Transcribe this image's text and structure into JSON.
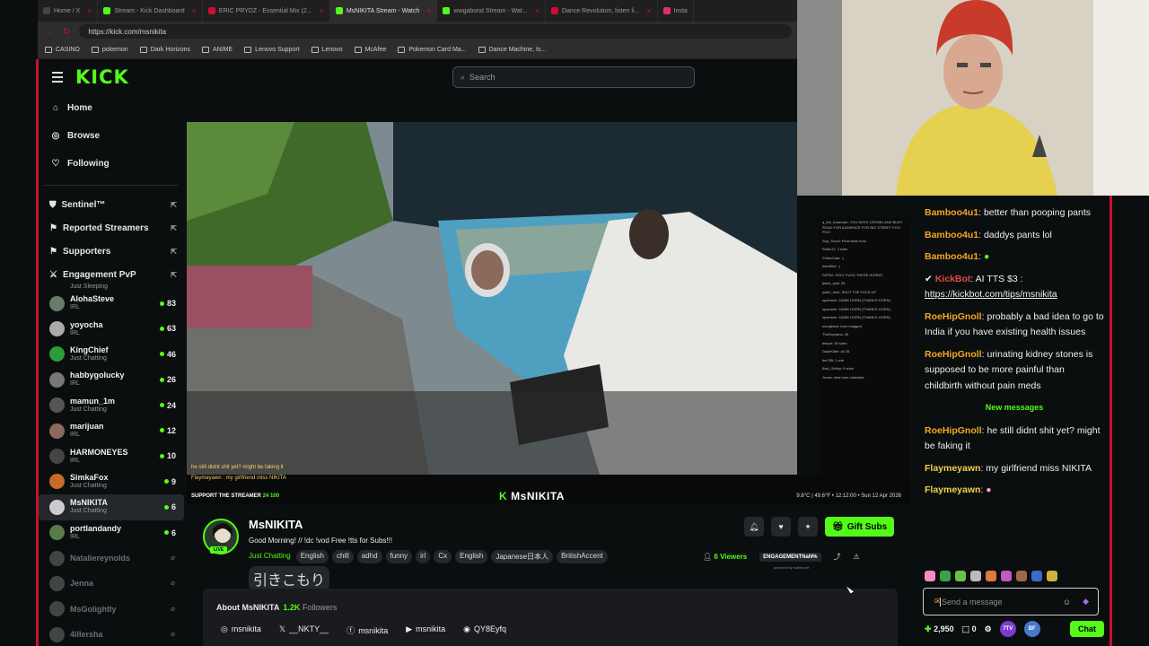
{
  "browser": {
    "tabs": [
      {
        "label": "Home / X",
        "active": false
      },
      {
        "label": "Stream - Kick Dashboard",
        "active": false
      },
      {
        "label": "ERIC PRYDZ - Essential Mix (2...",
        "active": false
      },
      {
        "label": "MsNIKITA Stream - Watch",
        "active": true
      },
      {
        "label": "wwgabond Stream - Wat...",
        "active": false
      },
      {
        "label": "Dance Revolution, listen li...",
        "active": false
      },
      {
        "label": "Insta",
        "active": false
      }
    ],
    "url": "https://kick.com/msnikita",
    "bookmarks": [
      "CASINO",
      "pokemon",
      "Dark Horizons",
      "ANIME",
      "Lenovo Support",
      "Lenovo",
      "McAfee",
      "Pokemon Card Ma...",
      "Dance Machine, Is..."
    ]
  },
  "header": {
    "logo": "KICK",
    "search_placeholder": "Search"
  },
  "sidebar": {
    "nav": [
      {
        "label": "Home",
        "icon": "home-icon"
      },
      {
        "label": "Browse",
        "icon": "compass-icon"
      },
      {
        "label": "Following",
        "icon": "heart-icon"
      }
    ],
    "sections": [
      {
        "label": "Sentinel™",
        "icon": "shield-icon"
      },
      {
        "label": "Reported Streamers",
        "icon": "flag-icon"
      },
      {
        "label": "Supporters",
        "icon": "users-icon"
      },
      {
        "label": "Engagement PvP",
        "icon": "swords-icon"
      }
    ],
    "partial_category": "Just Sleeping",
    "streamers": [
      {
        "name": "AlohaSteve",
        "category": "IRL",
        "viewers": "83",
        "online": true,
        "color": "#6a7a6a"
      },
      {
        "name": "yoyocha",
        "category": "IRL",
        "viewers": "63",
        "online": true,
        "color": "#aaa"
      },
      {
        "name": "KingChief",
        "category": "Just Chatting",
        "viewers": "46",
        "online": true,
        "color": "#2d9c3a"
      },
      {
        "name": "habbygolucky",
        "category": "IRL",
        "viewers": "26",
        "online": true,
        "color": "#777"
      },
      {
        "name": "mamun_1m",
        "category": "Just Chatting",
        "viewers": "24",
        "online": true,
        "color": "#555"
      },
      {
        "name": "marijuan",
        "category": "IRL",
        "viewers": "12",
        "online": true,
        "color": "#8a6a5a"
      },
      {
        "name": "HARMONEYES",
        "category": "IRL",
        "viewers": "10",
        "online": true,
        "color": "#444"
      },
      {
        "name": "SimkaFox",
        "category": "Just Chatting",
        "viewers": "9",
        "online": true,
        "color": "#c86a2a"
      },
      {
        "name": "MsNIKITA",
        "category": "Just Chatting",
        "viewers": "6",
        "online": true,
        "color": "#ccc",
        "active": true
      },
      {
        "name": "portlandandy",
        "category": "IRL",
        "viewers": "6",
        "online": true,
        "color": "#5a7a4a"
      },
      {
        "name": "Nataliereynolds",
        "category": "",
        "viewers": "",
        "online": false,
        "color": "#888"
      },
      {
        "name": "Jenna",
        "category": "",
        "viewers": "",
        "online": false,
        "color": "#888"
      },
      {
        "name": "MsGolightly",
        "category": "",
        "viewers": "",
        "online": false,
        "color": "#888"
      },
      {
        "name": "4illersha",
        "category": "",
        "viewers": "",
        "online": false,
        "color": "#888"
      }
    ]
  },
  "video": {
    "caption_overlay": "he still didnt shit yet? might be faking it",
    "overlay_line2": "Flaymeyawn : my girlfriend miss NIKITA",
    "support_text": "SUPPORT THE STREAMER",
    "support_counts": "24  100",
    "brand": "MsNIKITA",
    "status": "9.8°C | 49.6°F • 12:12:00 • Sun 12 Apr 2026",
    "chat_overlay": [
      "q_the_bossman: YOU NEED CROWD AND BUSY ROAD FOR AUDIENCE FOR BIG STREET POO POO",
      "Sup_Scoof: Final boss horn",
      "RollinJ1: 3 subs",
      "PoliceCats: :)",
      "bamMint: :)",
      "FATBZ: HOLY FUCK THESE HORNS",
      "jesus_split: 25",
      "justin_rach: SHUT THE FUCK UP",
      "spammer: DANK HORN (THANKS HORN)",
      "spammer: DANK HORN (THANKS HORN)",
      "spammer: DANK HORN (THANKS HORN)",
      "mengbard: horn mogged",
      "TheDryvains: 25",
      "teepot: 50 subs",
      "DashKiller: ok 25",
      "lee785: 1 sub",
      "Bud_Girtley: 5 subs",
      "Jones: new horn unlocked"
    ]
  },
  "channel": {
    "name": "MsNIKITA",
    "live_label": "LIVE",
    "title": "Good Morning! // !dc !vod  Free !tts for Subs!!!",
    "category": "Just Chatting",
    "tags": [
      "English",
      "chill",
      "adhd",
      "funny",
      "irl",
      "Cx",
      "English",
      "Japanese日本人",
      "BritishAccent"
    ],
    "tag_extra": "引きこもり",
    "gift_label": "Gift Subs",
    "viewers_label": "6 Viewers",
    "engagement_label": "ENGAGEMENTNaN%",
    "powered": "powered by botted.wtf"
  },
  "about": {
    "title": "About MsNIKITA",
    "followers_count": "1.2K",
    "followers_label": "Followers",
    "socials": [
      {
        "icon": "instagram-icon",
        "glyph": "◎",
        "label": "msnikita"
      },
      {
        "icon": "x-icon",
        "glyph": "𝕏",
        "label": "__NKTY__"
      },
      {
        "icon": "facebook-icon",
        "glyph": "ⓕ",
        "label": "msnikita"
      },
      {
        "icon": "youtube-icon",
        "glyph": "▶",
        "label": "msnikita"
      },
      {
        "icon": "discord-icon",
        "glyph": "◉",
        "label": "QY8Eyfq"
      }
    ]
  },
  "chat": {
    "messages_before": [
      {
        "user": "Bamboo4u1",
        "text": "better than pooping pants",
        "cls": "u-bamboo"
      },
      {
        "user": "Bamboo4u1",
        "text": "daddys pants lol",
        "cls": "u-bamboo"
      },
      {
        "user": "Bamboo4u1",
        "text": "",
        "cls": "u-bamboo",
        "emote": true
      },
      {
        "user": "KickBot",
        "text": "AI TTS $3 :",
        "link": "https://kickbot.com/tips/msnikita",
        "cls": "u-kick"
      },
      {
        "user": "RoeHipGnoll",
        "text": "probably a bad idea to go to India if you have existing health issues",
        "cls": "u-roe"
      },
      {
        "user": "RoeHipGnoll",
        "text": "urinating kidney stones is supposed to be more painful than childbirth without pain meds",
        "cls": "u-roe"
      }
    ],
    "new_messages_label": "New messages",
    "messages_after": [
      {
        "user": "RoeHipGnoll",
        "text": "he still didnt shit yet? might be faking it",
        "cls": "u-roe"
      },
      {
        "user": "Flaymeyawn",
        "text": "my girlfriend miss NIKITA",
        "cls": "u-flay"
      },
      {
        "user": "Flaymeyawn",
        "text": "",
        "cls": "u-flay",
        "emote": true
      }
    ],
    "input_placeholder": "Send a message",
    "points": "2,950",
    "drops": "0",
    "badge_7tv": "7TV",
    "badge_bf": "BF",
    "chat_button": "Chat"
  }
}
